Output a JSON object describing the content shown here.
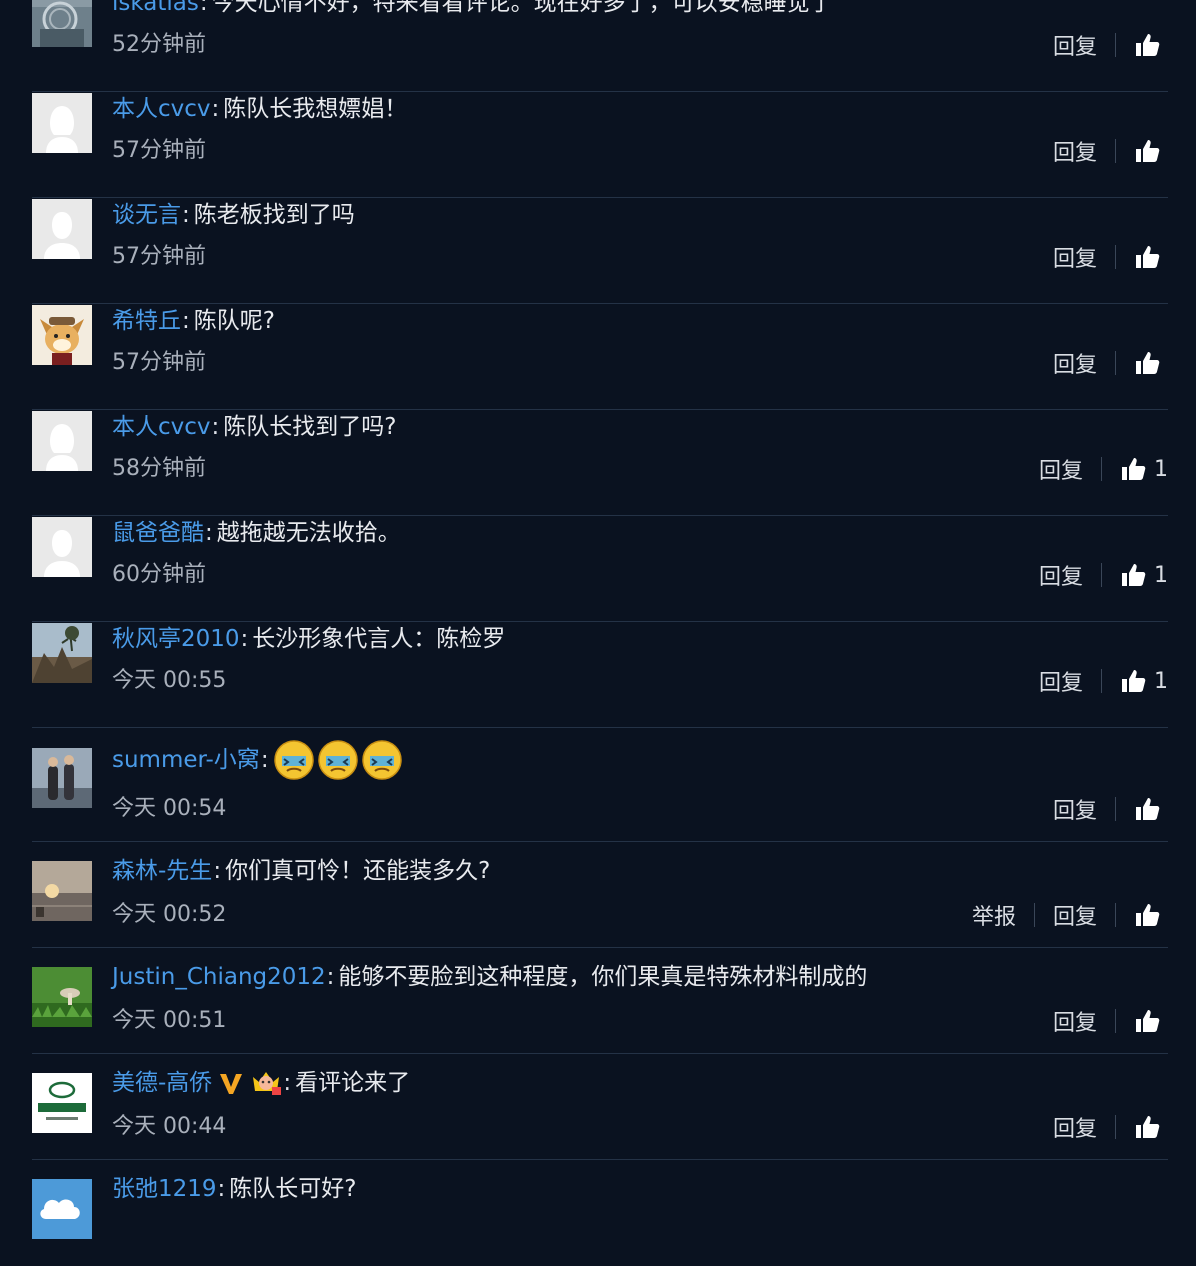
{
  "labels": {
    "reply": "回复",
    "report": "举报"
  },
  "colors": {
    "background": "#0a1220",
    "username": "#4a9be8",
    "divider": "#243246"
  },
  "comments": [
    {
      "user": "lskatlas",
      "text": "今天心情不好，特来看看评论。现在好多了，可以安稳睡觉了",
      "time": "52分钟前",
      "likes": "",
      "avatar": "basketball-hoop-photo"
    },
    {
      "user": "本人cvcv",
      "text": "陈队长我想嫖娼！",
      "time": "57分钟前",
      "likes": "",
      "avatar": "default-female"
    },
    {
      "user": "谈无言",
      "text": "陈老板找到了吗",
      "time": "57分钟前",
      "likes": "",
      "avatar": "default-male"
    },
    {
      "user": "希特丘",
      "text": "陈队呢?",
      "time": "57分钟前",
      "likes": "",
      "avatar": "cartoon-dog"
    },
    {
      "user": "本人cvcv",
      "text": "陈队长找到了吗?",
      "time": "58分钟前",
      "likes": "1",
      "avatar": "default-female"
    },
    {
      "user": "鼠爸爸酷",
      "text": "越拖越无法收拾。",
      "time": "60分钟前",
      "likes": "1",
      "avatar": "default-male"
    },
    {
      "user": "秋风亭2010",
      "text": "长沙形象代言人：陈检罗",
      "time": "今天 00:55",
      "likes": "1",
      "avatar": "landscape-photo"
    },
    {
      "user": "summer-小窝",
      "text": "",
      "emoji": [
        "dizzy-face-emoji",
        "dizzy-face-emoji",
        "dizzy-face-emoji"
      ],
      "time": "今天 00:54",
      "likes": "",
      "avatar": "couple-photo"
    },
    {
      "user": "森林-先生",
      "text": "你们真可怜！还能装多久?",
      "time": "今天 00:52",
      "likes": "",
      "report": true,
      "avatar": "sunset-photo"
    },
    {
      "user": "Justin_Chiang2012",
      "text": "能够不要脸到这种程度，你们果真是特殊材料制成的",
      "time": "今天 00:51",
      "likes": "",
      "avatar": "grass-mushroom-photo"
    },
    {
      "user": "美德-高侨",
      "text": "看评论来了",
      "time": "今天 00:44",
      "likes": "",
      "verified": true,
      "avatar": "company-logo"
    },
    {
      "user": "张弛1219",
      "text": "陈队长可好?",
      "time": "",
      "likes": "",
      "avatar": "cloud-logo"
    }
  ]
}
